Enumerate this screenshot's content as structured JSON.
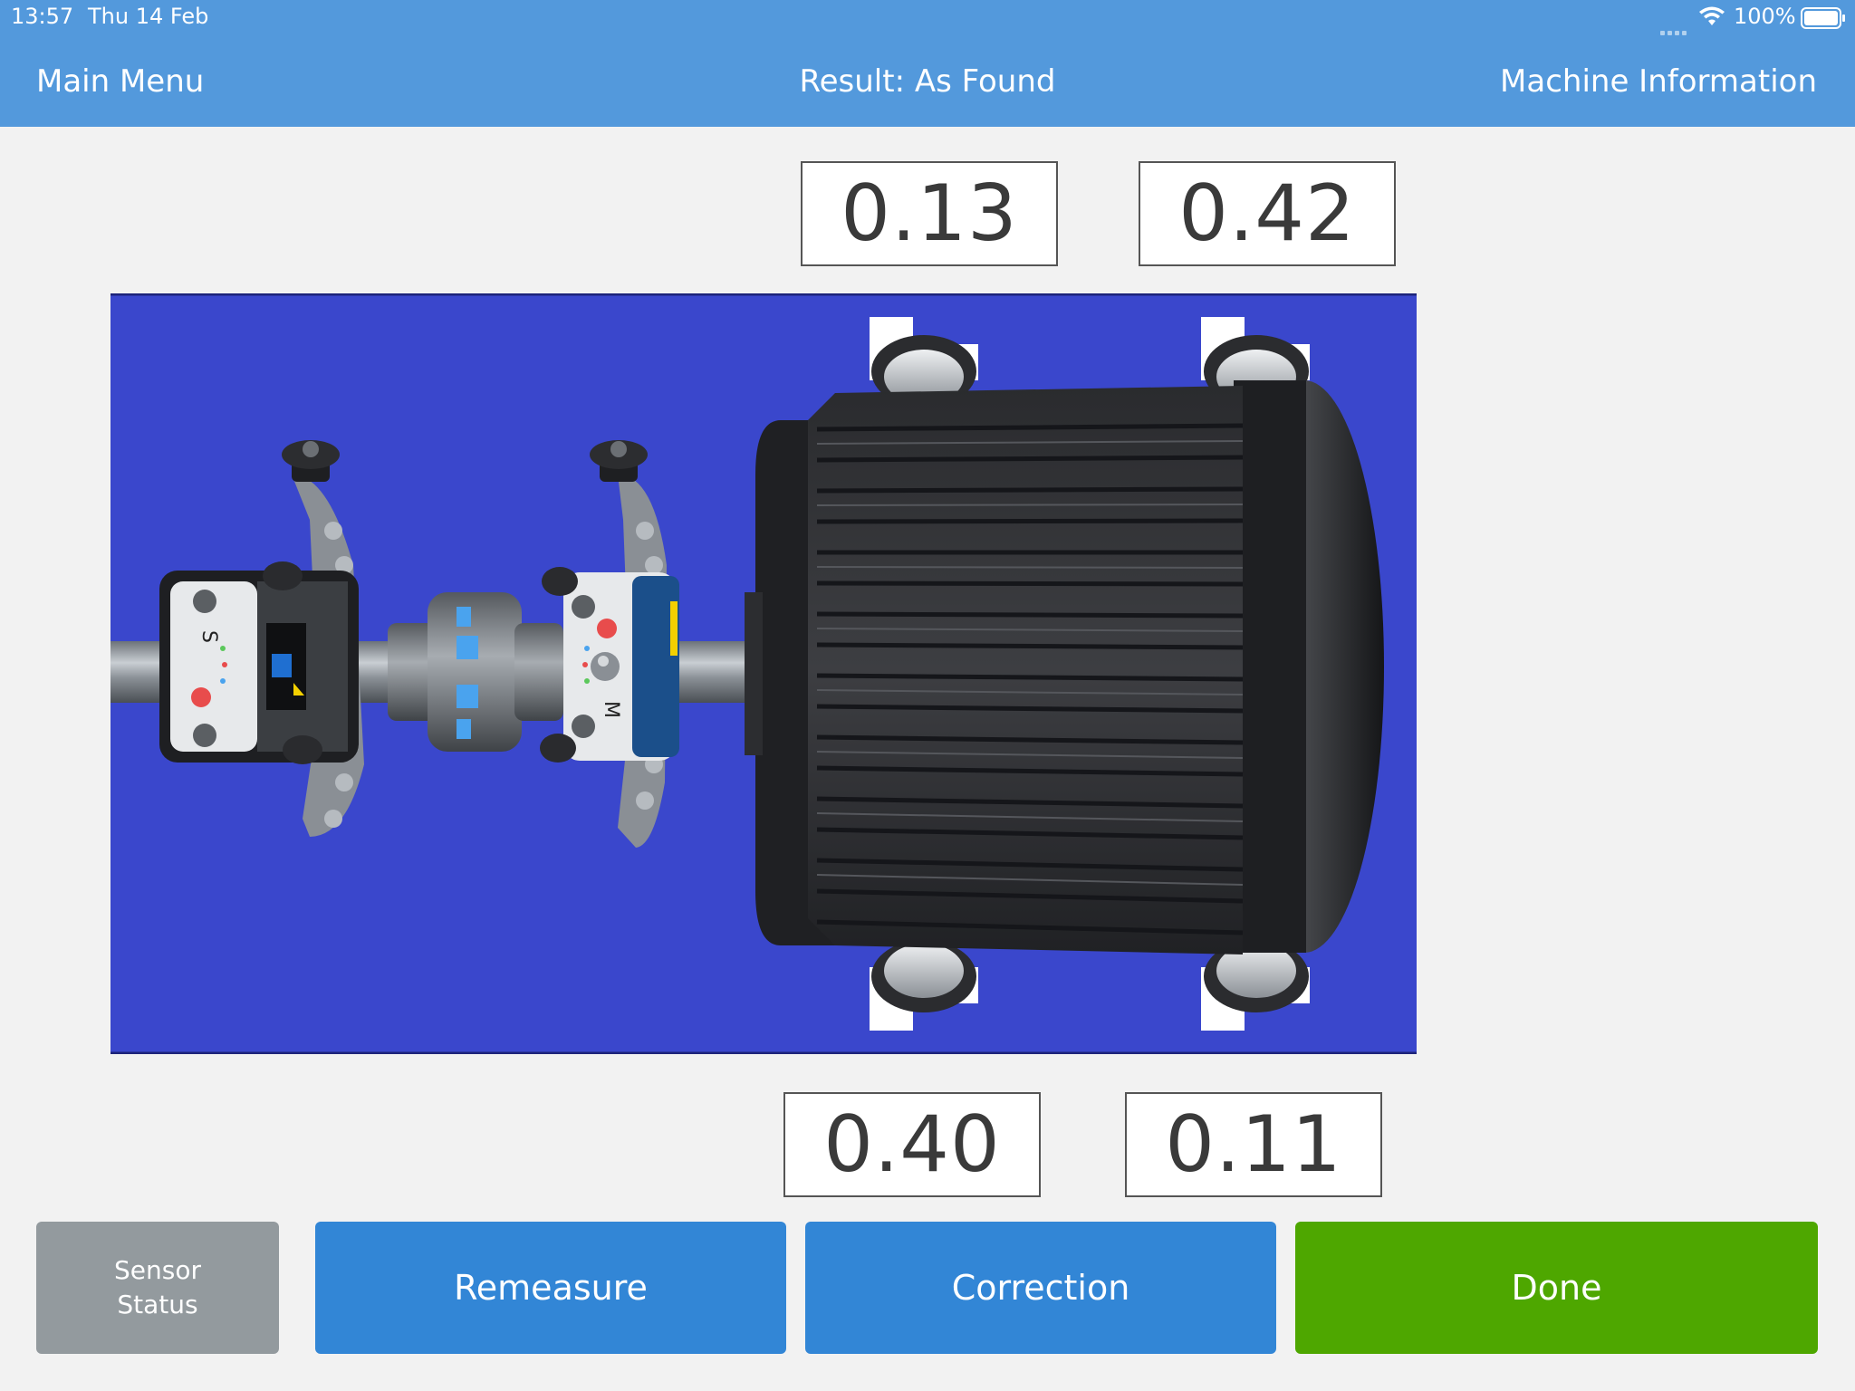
{
  "status_bar": {
    "time": "13:57",
    "date": "Thu 14 Feb",
    "battery": "100%"
  },
  "nav": {
    "left": "Main Menu",
    "title": "Result: As Found",
    "right": "Machine Information"
  },
  "values": {
    "top_left": "0.13",
    "top_right": "0.42",
    "bottom_left": "0.40",
    "bottom_right": "0.11"
  },
  "buttons": {
    "sensor_status": "Sensor\nStatus",
    "remeasure": "Remeasure",
    "correction": "Correction",
    "done": "Done"
  },
  "sensor_labels": {
    "stationary": "S",
    "movable": "M"
  },
  "colors": {
    "header": "#5399dc",
    "base_plate": "#3a47cc",
    "primary_button": "#3286d6",
    "done_button": "#4ea700",
    "sensor_button": "#939a9e"
  }
}
